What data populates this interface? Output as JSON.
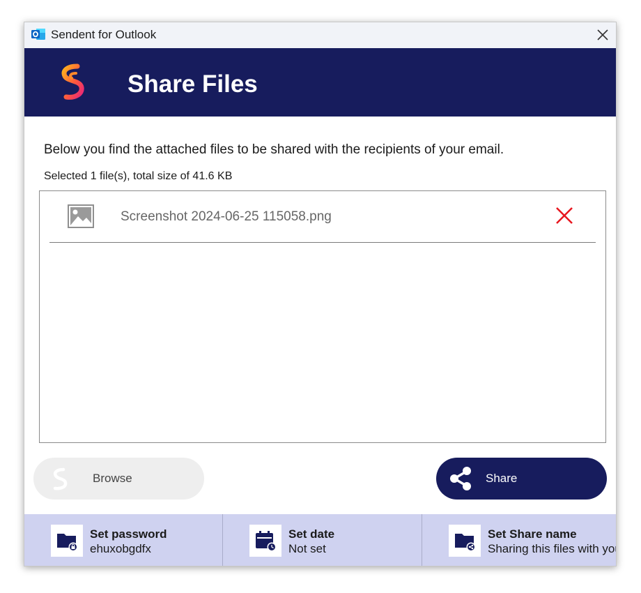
{
  "window": {
    "title": "Sendent for Outlook",
    "app_icon": "outlook-icon",
    "close_icon": "close-icon"
  },
  "header": {
    "title": "Share Files",
    "logo": "sendent-logo",
    "background": "#171c5d"
  },
  "main": {
    "description": "Below you find the attached files to be shared with the recipients of your email.",
    "summary": "Selected 1 file(s), total size of 41.6 KB",
    "files": [
      {
        "name": "Screenshot 2024-06-25 115058.png",
        "icon": "image-icon",
        "remove_icon": "red-x-icon"
      }
    ]
  },
  "actions": {
    "browse_label": "Browse",
    "share_label": "Share"
  },
  "options": [
    {
      "title": "Set password",
      "value": "ehuxobgdfx",
      "icon": "folder-lock-icon"
    },
    {
      "title": "Set date",
      "value": "Not set",
      "icon": "calendar-clock-icon"
    },
    {
      "title": "Set Share name",
      "value": "Sharing this files with you",
      "icon": "folder-share-icon"
    }
  ],
  "colors": {
    "accent": "#171c5d",
    "options_bar": "#cfd2f0",
    "remove": "#e8171f"
  }
}
